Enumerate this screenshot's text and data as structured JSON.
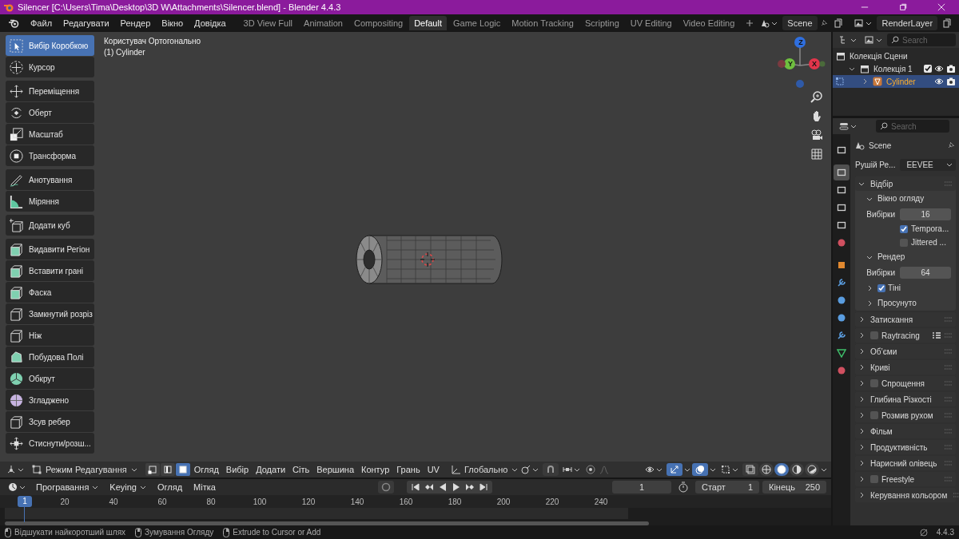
{
  "window": {
    "title": "Silencer [C:\\Users\\Tima\\Desktop\\3D W\\Attachments\\Silencer.blend] - Blender 4.4.3"
  },
  "menu": [
    "Файл",
    "Редагувати",
    "Рендер",
    "Вікно",
    "Довідка"
  ],
  "workspaces": [
    {
      "label": "3D View Full",
      "selected": false
    },
    {
      "label": "Animation",
      "selected": false
    },
    {
      "label": "Compositing",
      "selected": false
    },
    {
      "label": "Default",
      "selected": true
    },
    {
      "label": "Game Logic",
      "selected": false
    },
    {
      "label": "Motion Tracking",
      "selected": false
    },
    {
      "label": "Scripting",
      "selected": false
    },
    {
      "label": "UV Editing",
      "selected": false
    },
    {
      "label": "Video Editing",
      "selected": false
    }
  ],
  "scene": {
    "name": "Scene"
  },
  "view_layer": {
    "name": "RenderLayer"
  },
  "toolbar": {
    "groups": [
      [
        {
          "label": "Вибір Коробкою",
          "selected": true
        },
        {
          "label": "Курсор",
          "selected": false
        }
      ],
      [
        {
          "label": "Переміщення",
          "selected": false
        },
        {
          "label": "Оберт",
          "selected": false
        },
        {
          "label": "Масштаб",
          "selected": false
        },
        {
          "label": "Трансформа",
          "selected": false
        }
      ],
      [
        {
          "label": "Анотування",
          "selected": false
        },
        {
          "label": "Міряння",
          "selected": false
        }
      ],
      [
        {
          "label": "Додати куб",
          "selected": false
        }
      ],
      [
        {
          "label": "Видавити Регіон",
          "selected": false
        },
        {
          "label": "Вставити грані",
          "selected": false
        },
        {
          "label": "Фаска",
          "selected": false
        },
        {
          "label": "Замкнутий розріз",
          "selected": false
        },
        {
          "label": "Ніж",
          "selected": false
        },
        {
          "label": "Побудова Полі",
          "selected": false
        },
        {
          "label": "Обкрут",
          "selected": false
        },
        {
          "label": "Згладжено",
          "selected": false
        },
        {
          "label": "Зсув ребер",
          "selected": false
        },
        {
          "label": "Стиснути/розш...",
          "selected": false
        }
      ]
    ]
  },
  "viewport": {
    "view_name": "Користувач Ортогонально",
    "object_info": "(1) Cylinder",
    "gizmo_axes": [
      "Z",
      "Y",
      "X"
    ]
  },
  "viewport_header": {
    "mode": "Режим Редагування",
    "select_modes": [
      {
        "selected": false
      },
      {
        "selected": false
      },
      {
        "selected": true
      }
    ],
    "menus": [
      "Огляд",
      "Вибір",
      "Додати",
      "Сіть",
      "Вершина",
      "Контур",
      "Грань",
      "UV"
    ],
    "orientation": "Глобально",
    "snap": false,
    "gizmos_on": true,
    "overlays_on": true,
    "shading": [
      {
        "selected": false
      },
      {
        "selected": true
      },
      {
        "selected": false
      },
      {
        "selected": false
      }
    ]
  },
  "timeline": {
    "menus": [
      {
        "label": "Програвання",
        "dropdown": true
      },
      {
        "label": "Keying",
        "dropdown": true
      },
      {
        "label": "Огляд",
        "dropdown": false
      },
      {
        "label": "Мітка",
        "dropdown": false
      }
    ],
    "current_frame": "1",
    "start_label": "Старт",
    "start": "1",
    "end_label": "Кінець",
    "end": "250",
    "marker": "1",
    "ruler": [
      "20",
      "40",
      "60",
      "80",
      "100",
      "120",
      "140",
      "160",
      "180",
      "200",
      "220",
      "240"
    ]
  },
  "outliner": {
    "search": {
      "placeholder": "Search"
    },
    "tree": [
      {
        "label": "Колекція Сцени",
        "kind": "scene_collection",
        "selected": false,
        "children": [
          {
            "label": "Колекція 1",
            "kind": "collection",
            "selected": false,
            "expanded": true,
            "checked": true,
            "children": [
              {
                "label": "Cylinder",
                "kind": "object",
                "selected": true,
                "expanded": false
              }
            ]
          }
        ]
      }
    ]
  },
  "properties": {
    "search": {
      "placeholder": "Search"
    },
    "tabs": [
      {
        "selected": false
      },
      {
        "selected": true
      },
      {
        "selected": false
      },
      {
        "selected": false
      },
      {
        "selected": false
      },
      {
        "selected": false
      },
      {
        "selected": false
      },
      {
        "selected": false
      },
      {
        "selected": false
      },
      {
        "selected": false
      },
      {
        "selected": false
      },
      {
        "selected": false
      },
      {
        "selected": false
      }
    ],
    "context": "Scene",
    "engine_label": "Рушій Ре...",
    "engine": "EEVEE",
    "panels": [
      {
        "label": "Відбір",
        "expanded": true,
        "children": [
          {
            "label": "Вікно огляду",
            "expanded": true,
            "children": [
              {
                "kind": "number",
                "label": "Вибірки",
                "value": "16"
              },
              {
                "kind": "checkbox",
                "label": "Tempora...",
                "checked": true
              },
              {
                "kind": "checkbox",
                "label": "Jittered ...",
                "checked": false
              }
            ]
          },
          {
            "label": "Рендер",
            "expanded": true,
            "children": [
              {
                "kind": "number",
                "label": "Вибірки",
                "value": "64"
              }
            ]
          },
          {
            "label": "Тіні",
            "expanded": false,
            "checked": true
          },
          {
            "label": "Просунуто",
            "expanded": false
          }
        ]
      },
      {
        "label": "Затискання",
        "expanded": false
      },
      {
        "label": "Raytracing",
        "expanded": false,
        "checked": false,
        "presets_menu": true
      },
      {
        "label": "Об’єми",
        "expanded": false
      },
      {
        "label": "Криві",
        "expanded": false
      },
      {
        "label": "Спрощення",
        "expanded": false,
        "checked": false
      },
      {
        "label": "Глибина Різкості",
        "expanded": false
      },
      {
        "label": "Розмив рухом",
        "expanded": false,
        "checked": false
      },
      {
        "label": "Фільм",
        "expanded": false
      },
      {
        "label": "Продуктивність",
        "expanded": false
      },
      {
        "label": "Нарисний олівець",
        "expanded": false
      },
      {
        "label": "Freestyle",
        "expanded": false,
        "checked": false
      },
      {
        "label": "Керування кольором",
        "expanded": false
      }
    ]
  },
  "status_bar": {
    "hints": [
      "Відшукати найкоротший шлях",
      "Зумування Огляду",
      "Extrude to Cursor or Add"
    ],
    "version": "4.4.3"
  }
}
